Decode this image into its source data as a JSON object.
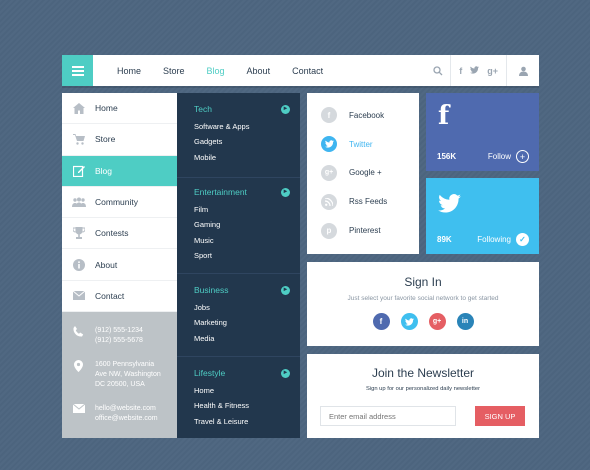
{
  "topbar": {
    "nav": [
      "Home",
      "Store",
      "Blog",
      "About",
      "Contact"
    ],
    "active_nav": "Blog"
  },
  "sidebar": {
    "items": [
      {
        "label": "Home",
        "icon": "home-icon"
      },
      {
        "label": "Store",
        "icon": "cart-icon"
      },
      {
        "label": "Blog",
        "icon": "edit-icon"
      },
      {
        "label": "Community",
        "icon": "people-icon"
      },
      {
        "label": "Contests",
        "icon": "trophy-icon"
      },
      {
        "label": "About",
        "icon": "info-icon"
      },
      {
        "label": "Contact",
        "icon": "mail-icon"
      }
    ],
    "phone": [
      "(912) 555-1234",
      "(912) 555-5678"
    ],
    "address": [
      "1600 Pennsylvania",
      "Ave NW, Washington",
      "DC 20500, USA"
    ],
    "email": [
      "hello@website.com",
      "office@website.com"
    ]
  },
  "categories": [
    {
      "title": "Tech",
      "items": [
        "Software & Apps",
        "Gadgets",
        "Mobile"
      ]
    },
    {
      "title": "Entertainment",
      "items": [
        "Film",
        "Gaming",
        "Music",
        "Sport"
      ]
    },
    {
      "title": "Business",
      "items": [
        "Jobs",
        "Marketing",
        "Media"
      ]
    },
    {
      "title": "Lifestyle",
      "items": [
        "Home",
        "Health & Fitness",
        "Travel & Leisure"
      ]
    }
  ],
  "social_list": [
    {
      "label": "Facebook",
      "glyph": "f"
    },
    {
      "label": "Twitter",
      "glyph": "t"
    },
    {
      "label": "Google +",
      "glyph": "g+"
    },
    {
      "label": "Rss Feeds",
      "glyph": "r"
    },
    {
      "label": "Pinterest",
      "glyph": "p"
    }
  ],
  "facebook_card": {
    "count": "156K",
    "action": "Follow",
    "logo": "f"
  },
  "twitter_card": {
    "count": "89K",
    "action": "Following",
    "logo": "t"
  },
  "signin": {
    "title": "Sign In",
    "subtitle": "Just select your favorite social network to get started"
  },
  "newsletter": {
    "title": "Join the Newsletter",
    "subtitle": "Sign up for our personalized daily newsletter",
    "placeholder": "Enter email address",
    "button": "SIGN UP"
  },
  "colors": {
    "accent": "#4ecdc4",
    "dark": "#22374d",
    "facebook": "#4f6aaf",
    "twitter": "#3fbfef",
    "google": "#e55e63",
    "linkedin": "#2a84b8"
  }
}
